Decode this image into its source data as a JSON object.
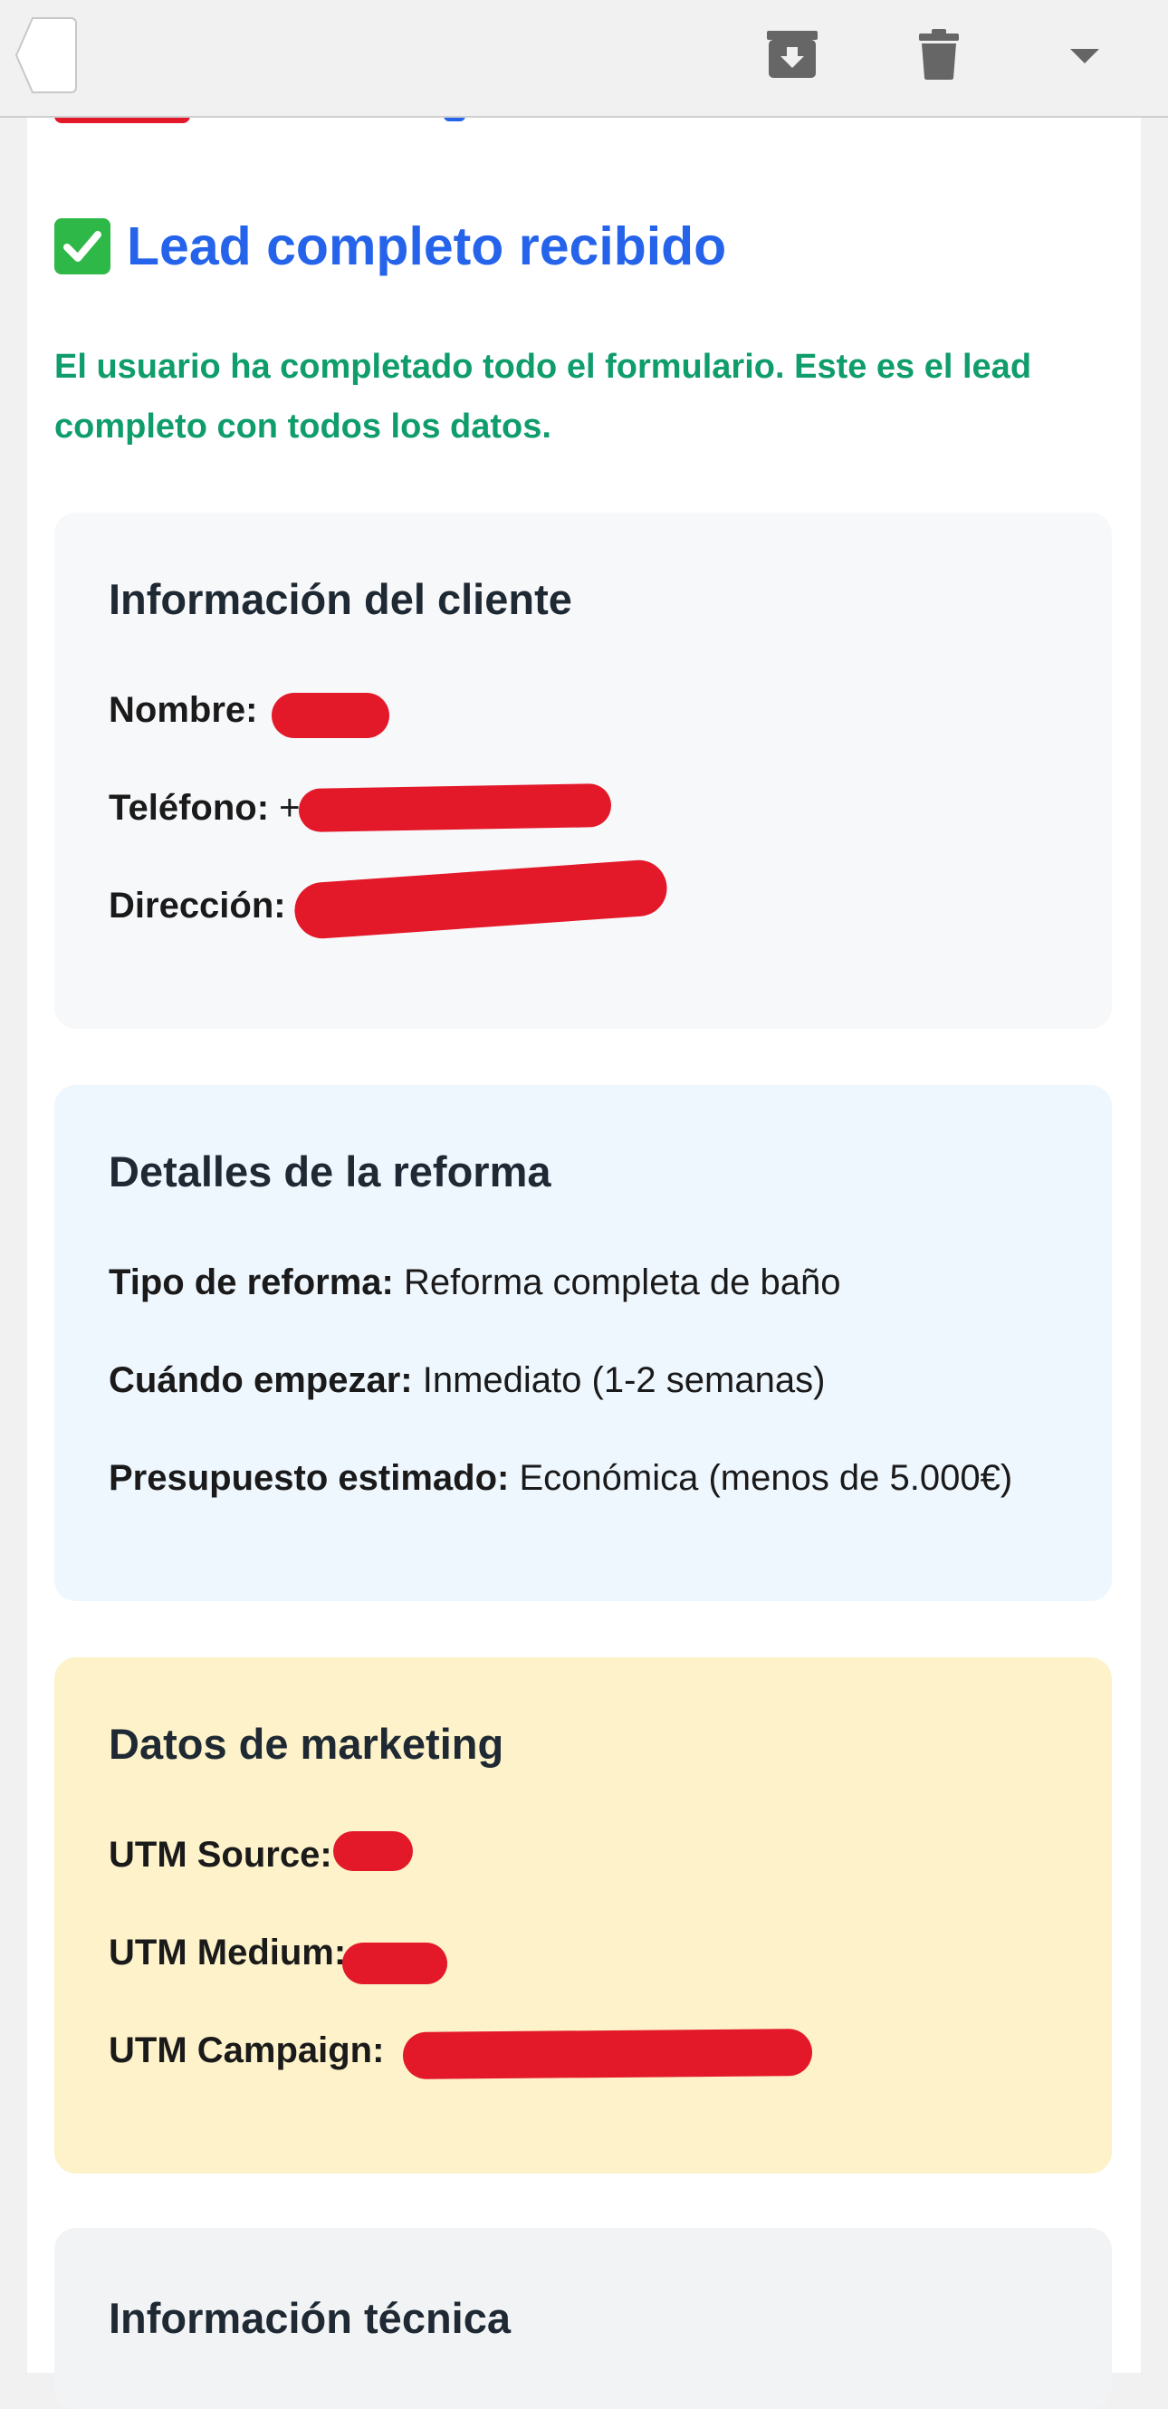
{
  "toolbar": {
    "back_icon": "back-arrow-icon",
    "archive_icon": "archive-icon",
    "delete_icon": "trash-icon",
    "more_icon": "chevron-down-icon"
  },
  "email": {
    "title": "Lead completo recibido",
    "title_emoji": "✅",
    "intro": "El usuario ha completado todo el formulario. Este es el lead completo con todos los datos.",
    "sections": {
      "client": {
        "title": "Información del cliente",
        "rows": [
          {
            "label": "Nombre:",
            "value": ""
          },
          {
            "label": "Teléfono:",
            "value": "+"
          },
          {
            "label": "Dirección:",
            "value": ""
          }
        ]
      },
      "reform": {
        "title": "Detalles de la reforma",
        "rows": [
          {
            "label": "Tipo de reforma:",
            "value": "Reforma completa de baño"
          },
          {
            "label": "Cuándo empezar:",
            "value": "Inmediato (1-2 semanas)"
          },
          {
            "label": "Presupuesto estimado:",
            "value": "Económica (menos de 5.000€)"
          }
        ]
      },
      "marketing": {
        "title": "Datos de marketing",
        "rows": [
          {
            "label": "UTM Source:",
            "value": ""
          },
          {
            "label": "UTM Medium:",
            "value": ""
          },
          {
            "label": "UTM Campaign:",
            "value": ""
          }
        ]
      },
      "technical": {
        "title": "Información técnica"
      }
    }
  },
  "colors": {
    "title_blue": "#2563eb",
    "intro_green": "#0f9d6b",
    "redaction_red": "#e3192a",
    "client_bg": "#f7f8fa",
    "reform_bg": "#eef6fe",
    "marketing_bg": "#fdf2c9"
  }
}
